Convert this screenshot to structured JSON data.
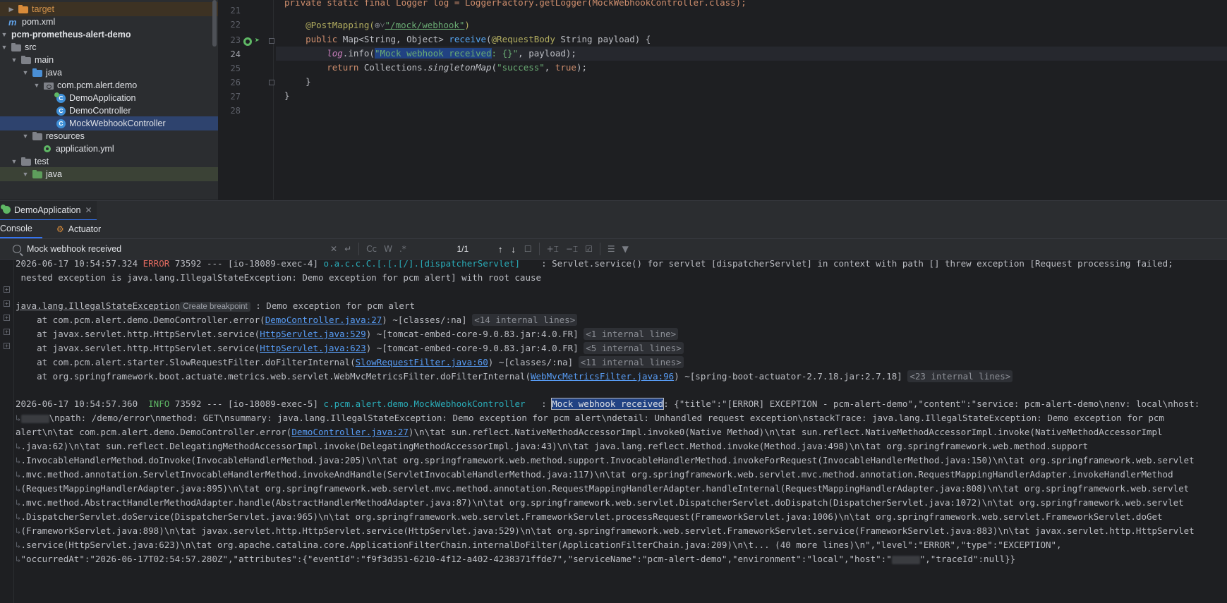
{
  "tree": {
    "items": [
      {
        "label": "target",
        "kind": "folder-orange"
      },
      {
        "label": "pom.xml",
        "kind": "maven"
      },
      {
        "label": "pcm-prometheus-alert-demo",
        "kind": "module"
      },
      {
        "label": "src",
        "kind": "folder"
      },
      {
        "label": "main",
        "kind": "folder"
      },
      {
        "label": "java",
        "kind": "folder-blue"
      },
      {
        "label": "com.pcm.alert.demo",
        "kind": "package"
      },
      {
        "label": "DemoApplication",
        "kind": "class-spring"
      },
      {
        "label": "DemoController",
        "kind": "class"
      },
      {
        "label": "MockWebhookController",
        "kind": "class"
      },
      {
        "label": "resources",
        "kind": "folder-res"
      },
      {
        "label": "application.yml",
        "kind": "yml"
      },
      {
        "label": "test",
        "kind": "folder"
      },
      {
        "label": "java",
        "kind": "folder-green"
      }
    ]
  },
  "editor": {
    "line_numbers": [
      "21",
      "22",
      "23",
      "24",
      "25",
      "26",
      "27",
      "28"
    ],
    "line21": "private static final Logger log = LoggerFactory.getLogger(MockWebhookController.class);",
    "l22_ann": "@PostMapping(",
    "l22_icon": "⊕˅",
    "l22_url": "\"/mock/webhook\"",
    "l22_close": ")",
    "l23_public": "public ",
    "l23_type": "Map<String, Object> ",
    "l23_fn": "receive",
    "l23_open": "(",
    "l23_ann": "@RequestBody ",
    "l23_rest": "String payload) {",
    "l24_log": "log",
    "l24_info": ".info(",
    "l24_str_sel": "\"Mock webhook received",
    "l24_str_rest": ": {}\"",
    "l24_rest": ", payload);",
    "l25_return": "return ",
    "l25_cls": "Collections.",
    "l25_fn": "singletonMap",
    "l25_open": "(",
    "l25_str": "\"success\"",
    "l25_comma": ", ",
    "l25_true": "true",
    "l25_close": ");",
    "l26": "}",
    "l27": "}"
  },
  "run": {
    "tab_label": "DemoApplication",
    "console_tab": "Console",
    "actuator_tab": "Actuator"
  },
  "find": {
    "query": "Mock webhook received",
    "match_count": "1/1",
    "opt_case": "Cc",
    "opt_word": "W",
    "opt_regex": ".*"
  },
  "console": {
    "l0_ts": "2026-06-17 10:54:57.324 ",
    "l0_level": "ERROR",
    "l0_mid": " 73592 --- [io-18089-exec-4] ",
    "l0_logger": "o.a.c.c.C.[.[.[/].[dispatcherServlet]",
    "l0_msg": "    : Servlet.service() for servlet [dispatcherServlet] in context with path [] threw exception [Request processing failed;",
    "l1": " nested exception is java.lang.IllegalStateException: Demo exception for pcm alert] with root cause",
    "l3_exc": "java.lang.IllegalStateException",
    "l3_chip": "Create breakpoint",
    "l3_msg": " : Demo exception for pcm alert",
    "st": [
      {
        "pre": "    at com.pcm.alert.demo.DemoController.error(",
        "link": "DemoController.java:27",
        "post": ") ~[classes/:na] ",
        "internal": "<14 internal lines>"
      },
      {
        "pre": "    at javax.servlet.http.HttpServlet.service(",
        "link": "HttpServlet.java:529",
        "post": ") ~[tomcat-embed-core-9.0.83.jar:4.0.FR] ",
        "internal": "<1 internal line>"
      },
      {
        "pre": "    at javax.servlet.http.HttpServlet.service(",
        "link": "HttpServlet.java:623",
        "post": ") ~[tomcat-embed-core-9.0.83.jar:4.0.FR] ",
        "internal": "<5 internal lines>"
      },
      {
        "pre": "    at com.pcm.alert.starter.SlowRequestFilter.doFilterInternal(",
        "link": "SlowRequestFilter.java:60",
        "post": ") ~[classes/:na] ",
        "internal": "<11 internal lines>"
      },
      {
        "pre": "    at org.springframework.boot.actuate.metrics.web.servlet.WebMvcMetricsFilter.doFilterInternal(",
        "link": "WebMvcMetricsFilter.java:96",
        "post": ") ~[spring-boot-actuator-2.7.18.jar:2.7.18] ",
        "internal": "<23 internal lines>"
      }
    ],
    "i_ts": "2026-06-17 10:54:57.360  ",
    "i_level": "INFO",
    "i_mid": " 73592 --- [io-18089-exec-5] ",
    "i_logger": "c.pcm.alert.demo.MockWebhookController",
    "i_gap": "   : ",
    "i_match": "Mock webhook received",
    "i_rest": ": {\"title\":\"[ERROR] EXCEPTION - pcm-alert-demo\",\"content\":\"service: pcm-alert-demo\\nenv: local\\nhost:",
    "w1": "\\npath: /demo/error\\nmethod: GET\\nsummary: java.lang.IllegalStateException: Demo exception for pcm alert\\ndetail: Unhandled request exception\\nstackTrace: java.lang.IllegalStateException: Demo exception for pcm",
    "w2_pre": "alert\\n\\tat com.pcm.alert.demo.DemoController.error(",
    "w2_link": "DemoController.java:27",
    "w2_post": ")\\n\\tat sun.reflect.NativeMethodAccessorImpl.invoke0(Native Method)\\n\\tat sun.reflect.NativeMethodAccessorImpl.invoke(NativeMethodAccessorImpl",
    "w3": ".java:62)\\n\\tat sun.reflect.DelegatingMethodAccessorImpl.invoke(DelegatingMethodAccessorImpl.java:43)\\n\\tat java.lang.reflect.Method.invoke(Method.java:498)\\n\\tat org.springframework.web.method.support",
    "w4": ".InvocableHandlerMethod.doInvoke(InvocableHandlerMethod.java:205)\\n\\tat org.springframework.web.method.support.InvocableHandlerMethod.invokeForRequest(InvocableHandlerMethod.java:150)\\n\\tat org.springframework.web.servlet",
    "w5": ".mvc.method.annotation.ServletInvocableHandlerMethod.invokeAndHandle(ServletInvocableHandlerMethod.java:117)\\n\\tat org.springframework.web.servlet.mvc.method.annotation.RequestMappingHandlerAdapter.invokeHandlerMethod",
    "w6": "(RequestMappingHandlerAdapter.java:895)\\n\\tat org.springframework.web.servlet.mvc.method.annotation.RequestMappingHandlerAdapter.handleInternal(RequestMappingHandlerAdapter.java:808)\\n\\tat org.springframework.web.servlet",
    "w7": ".mvc.method.AbstractHandlerMethodAdapter.handle(AbstractHandlerMethodAdapter.java:87)\\n\\tat org.springframework.web.servlet.DispatcherServlet.doDispatch(DispatcherServlet.java:1072)\\n\\tat org.springframework.web.servlet",
    "w8": ".DispatcherServlet.doService(DispatcherServlet.java:965)\\n\\tat org.springframework.web.servlet.FrameworkServlet.processRequest(FrameworkServlet.java:1006)\\n\\tat org.springframework.web.servlet.FrameworkServlet.doGet",
    "w9": "(FrameworkServlet.java:898)\\n\\tat javax.servlet.http.HttpServlet.service(HttpServlet.java:529)\\n\\tat org.springframework.web.servlet.FrameworkServlet.service(FrameworkServlet.java:883)\\n\\tat javax.servlet.http.HttpServlet",
    "w10": ".service(HttpServlet.java:623)\\n\\tat org.apache.catalina.core.ApplicationFilterChain.internalDoFilter(ApplicationFilterChain.java:209)\\n\\t... (40 more lines)\\n\",\"level\":\"ERROR\",\"type\":\"EXCEPTION\",",
    "w11_pre": "\"occurredAt\":\"2026-06-17T02:54:57.280Z\",\"attributes\":{\"eventId\":\"f9f3d351-6210-4f12-a402-4238371ffde7\",\"serviceName\":\"pcm-alert-demo\",\"environment\":\"local\",\"host\":\"",
    "w11_post": "\",\"traceId\":null}}"
  }
}
